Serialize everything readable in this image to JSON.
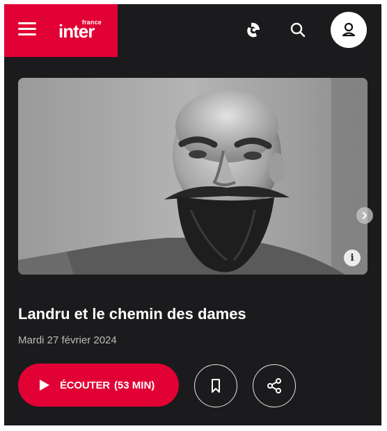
{
  "header": {
    "logo_small": "france",
    "logo_big": "inter",
    "menu_icon": "hamburger-menu-icon",
    "live_icon": "live-radio-icon",
    "search_icon": "search-icon",
    "account_icon": "user-icon",
    "brand_color": "#e20134"
  },
  "hero": {
    "image_description_icon": "info-icon",
    "info_label": "i",
    "carousel_icon": "chevron-right-icon"
  },
  "episode": {
    "title": "Landru et le chemin des dames",
    "date": "Mardi 27 février 2024"
  },
  "actions": {
    "listen_label": "ÉCOUTER",
    "listen_duration": "(53 MIN)",
    "play_icon": "play-icon",
    "bookmark_icon": "bookmark-icon",
    "share_icon": "share-icon"
  }
}
